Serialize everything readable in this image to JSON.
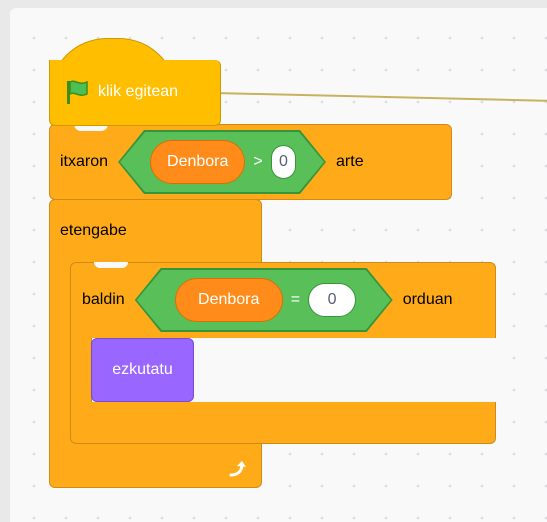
{
  "colors": {
    "events": "#ffbf00",
    "control": "#ffab19",
    "operators": "#59c059",
    "variables": "#ff8c1a",
    "looks": "#9966ff"
  },
  "blocks": {
    "hat": {
      "label": "klik egitean",
      "icon": "green-flag-icon"
    },
    "wait_until": {
      "prefix": "itxaron",
      "variable": "Denbora",
      "operator": ">",
      "value": "0",
      "suffix": "arte"
    },
    "forever": {
      "label": "etengabe",
      "icon": "loop-arrow-icon"
    },
    "if_block": {
      "prefix": "baldin",
      "variable": "Denbora",
      "operator": "=",
      "value": "0",
      "suffix": "orduan"
    },
    "hide": {
      "label": "ezkutatu"
    }
  }
}
